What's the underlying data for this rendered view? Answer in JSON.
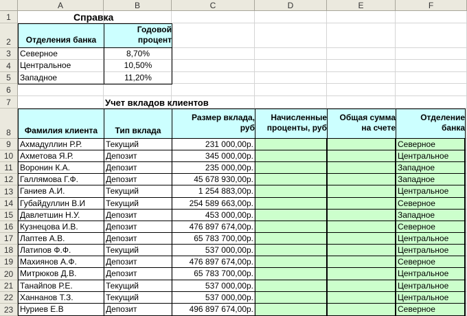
{
  "columns": [
    "A",
    "B",
    "C",
    "D",
    "E",
    "F"
  ],
  "rows": [
    "1",
    "2",
    "3",
    "4",
    "5",
    "6",
    "7",
    "8",
    "9",
    "10",
    "11",
    "12",
    "13",
    "14",
    "15",
    "16",
    "17",
    "18",
    "19",
    "20",
    "21",
    "22",
    "23"
  ],
  "ref": {
    "title": "Справка",
    "col1_header": "Отделения банка",
    "col2_header_l1": "Годовой",
    "col2_header_l2": "процент",
    "rows": [
      {
        "branch": "Северное",
        "rate": "8,70%"
      },
      {
        "branch": "Центральное",
        "rate": "10,50%"
      },
      {
        "branch": "Западное",
        "rate": "11,20%"
      }
    ]
  },
  "main": {
    "title": "Учет вкладов клиентов",
    "headers": {
      "name": "Фамилия клиента",
      "type": "Тип вклада",
      "amount_l1": "Размер вклада,",
      "amount_l2": "руб",
      "interest_l1": "Начисленные",
      "interest_l2": "проценты, руб",
      "total_l1": "Общая сумма",
      "total_l2": "на счете",
      "branch_l1": "Отделение",
      "branch_l2": "банка"
    },
    "rows": [
      {
        "name": "Ахмадуллин Р.Р.",
        "type": "Текущий",
        "amount": "231 000,00р.",
        "branch": "Северное"
      },
      {
        "name": "Ахметова Я.Р.",
        "type": "Депозит",
        "amount": "345 000,00р.",
        "branch": "Центральное"
      },
      {
        "name": "Воронин К.А.",
        "type": "Депозит",
        "amount": "235 000,00р.",
        "branch": "Западное"
      },
      {
        "name": "Галлямова Г.Ф.",
        "type": "Депозит",
        "amount": "45 678 930,00р.",
        "branch": "Западное"
      },
      {
        "name": "Ганиев А.И.",
        "type": "Текущий",
        "amount": "1 254 883,00р.",
        "branch": "Центральное"
      },
      {
        "name": "Губайдуллин В.И",
        "type": "Текущий",
        "amount": "254 589 663,00р.",
        "branch": "Северное"
      },
      {
        "name": "Давлетшин Н.У.",
        "type": "Депозит",
        "amount": "453 000,00р.",
        "branch": "Западное"
      },
      {
        "name": "Кузнецова И.В.",
        "type": "Депозит",
        "amount": "476 897 674,00р.",
        "branch": "Северное"
      },
      {
        "name": "Лаптев А.В.",
        "type": "Депозит",
        "amount": "65 783 700,00р.",
        "branch": "Центральное"
      },
      {
        "name": "Латипов Ф.Ф.",
        "type": "Текущий",
        "amount": "537 000,00р.",
        "branch": "Центральное"
      },
      {
        "name": "Махиянов А.Ф.",
        "type": "Депозит",
        "amount": "476 897 674,00р.",
        "branch": "Северное"
      },
      {
        "name": "Митрюков Д.В.",
        "type": "Депозит",
        "amount": "65 783 700,00р.",
        "branch": "Центральное"
      },
      {
        "name": "Танайпов Р.Е.",
        "type": "Текущий",
        "amount": "537 000,00р.",
        "branch": "Центральное"
      },
      {
        "name": "Ханнанов Т.З.",
        "type": "Текущий",
        "amount": "537 000,00р.",
        "branch": "Центральное"
      },
      {
        "name": "Нуриев Е.В",
        "type": "Депозит",
        "amount": "496 897 674,00р.",
        "branch": "Северное"
      }
    ]
  },
  "colors": {
    "header_fill": "#ccffff",
    "calc_fill": "#ccffcc",
    "chrome": "#ebe9de"
  }
}
